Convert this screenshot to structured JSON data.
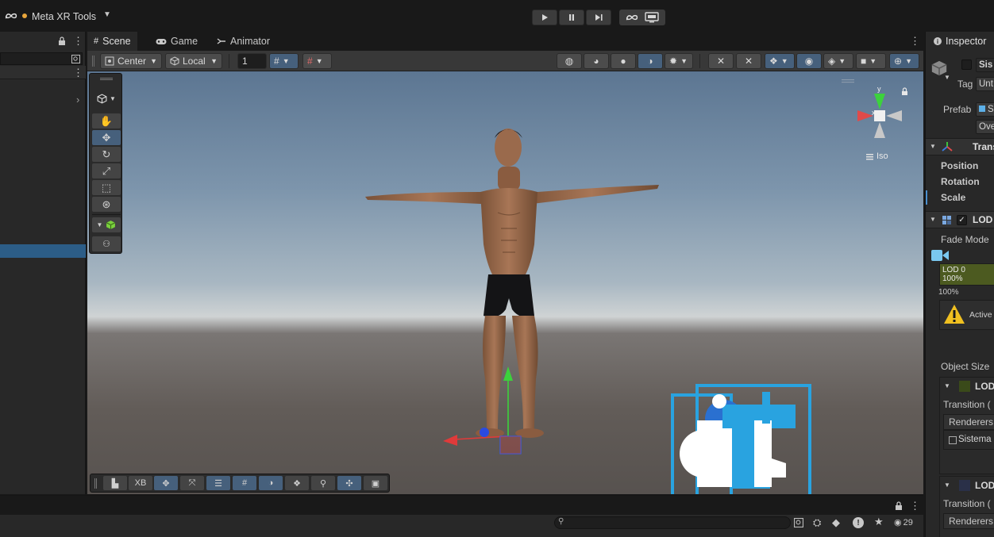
{
  "app": {
    "title": "Meta XR Tools"
  },
  "tabs": {
    "scene": "Scene",
    "game": "Game",
    "animator": "Animator"
  },
  "scene_toolbar": {
    "pivot": "Center",
    "space": "Local",
    "grid_value": "1"
  },
  "viewport": {
    "orientation_label": "Iso",
    "axis_x": "x",
    "axis_y": "y"
  },
  "overlay_bar": {
    "xb_label": "XB"
  },
  "inspector": {
    "title": "Inspector",
    "object_name": "Sis",
    "tag_label": "Tag",
    "tag_value": "Unt",
    "prefab_label": "Prefab",
    "prefab_value": "S",
    "overrides_value": "Ove",
    "transform_header": "Trans",
    "position_label": "Position",
    "rotation_label": "Rotation",
    "scale_label": "Scale",
    "lod_header": "LOD",
    "fade_mode_label": "Fade Mode",
    "lod0_label": "LOD 0",
    "lod0_percent": "100%",
    "lod_bottom_percent": "100%",
    "warning_text": "Active",
    "object_size_label": "Object Size",
    "lod_item1": "LOD",
    "transition_label1": "Transition (",
    "renderers_label1": "Renderers",
    "renderer_item1": "Sistema",
    "lod_item2": "LOD",
    "transition_label2": "Transition (",
    "renderers_label2": "Renderers"
  },
  "console": {
    "visibility_count": "29"
  },
  "colors": {
    "accent_blue": "#46607c",
    "selection_blue": "#2c5d87",
    "gizmo_cyan": "#29a3e0",
    "lod0_green": "#4c5a20"
  }
}
